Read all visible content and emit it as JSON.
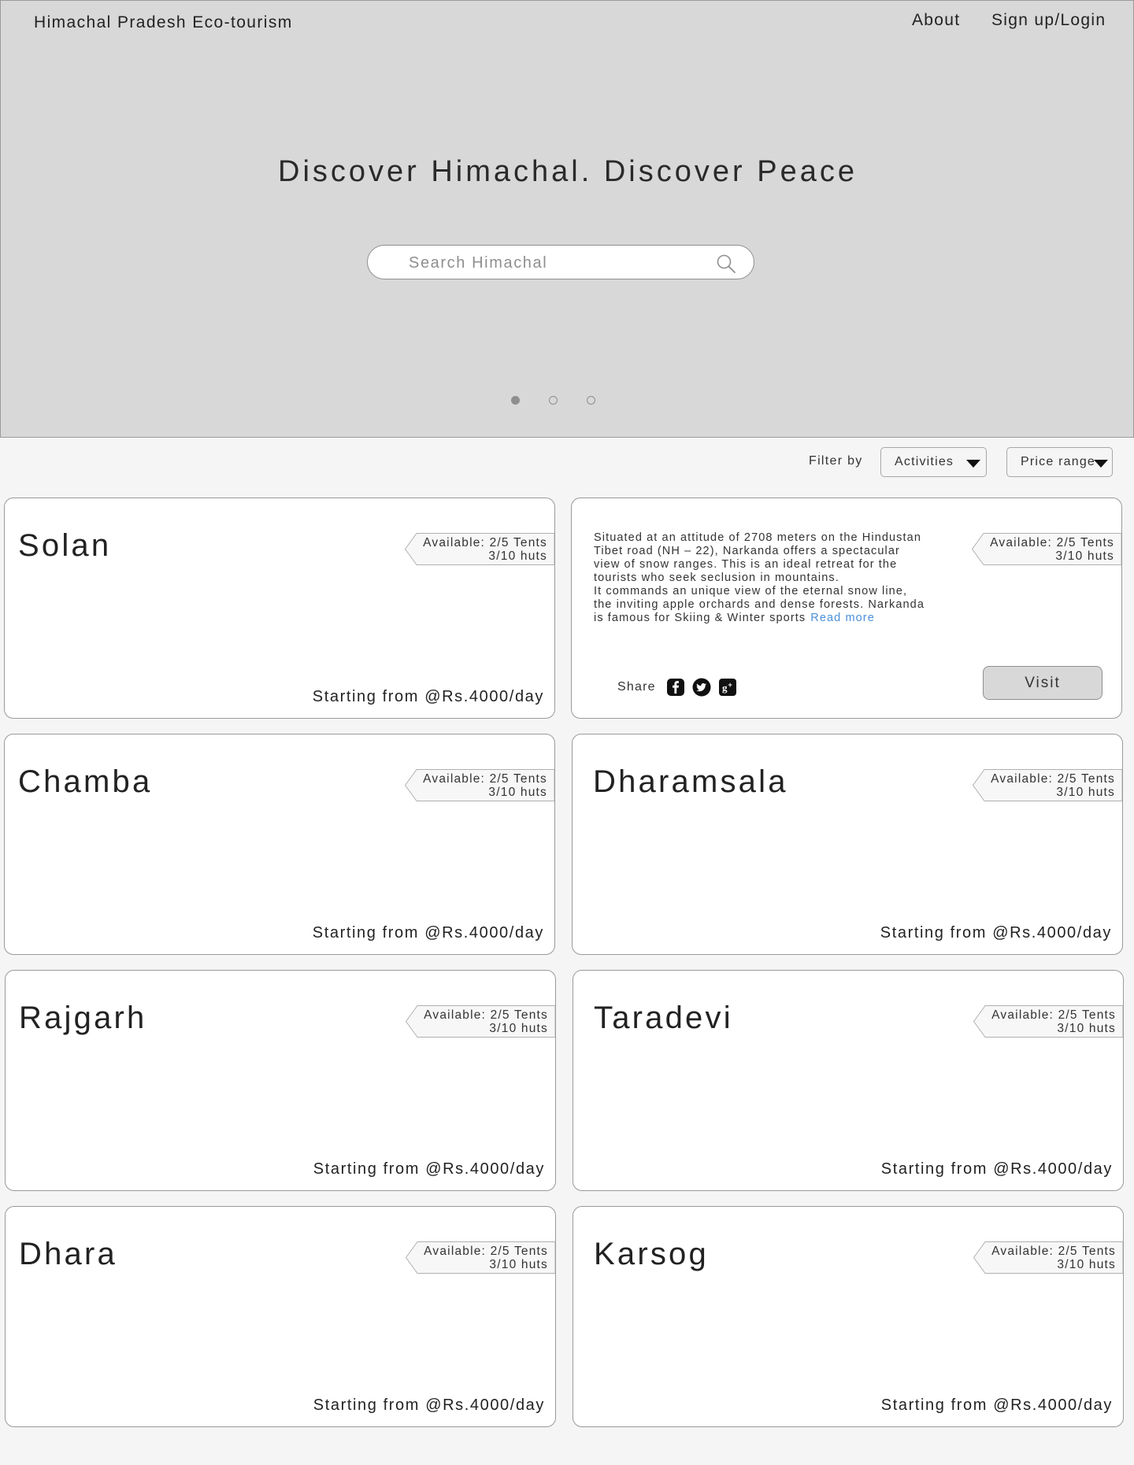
{
  "header": {
    "brand": "Himachal Pradesh Eco-tourism",
    "nav": {
      "about": "About",
      "login": "Sign up/Login"
    }
  },
  "hero": {
    "title": "Discover Himachal. Discover Peace",
    "search_placeholder": "Search Himachal",
    "carousel": {
      "count": 3,
      "active_index": 0
    }
  },
  "filters": {
    "label": "Filter by",
    "activities": "Activities",
    "price_range": "Price range"
  },
  "featured": {
    "description_lines": [
      "Situated at an attitude of 2708 meters on the Hindustan Tibet road (NH – 22), Narkanda offers a spectacular view of snow ranges. This is an ideal retreat for the tourists who seek seclusion in mountains.",
      "It commands an unique view of the eternal snow line, the inviting apple orchards and dense forests. Narkanda is famous for Skiing & Winter sports"
    ],
    "read_more": "Read more",
    "share_label": "Share",
    "social_icons": [
      "facebook-icon",
      "twitter-icon",
      "google-plus-icon"
    ],
    "visit_label": "Visit",
    "availability": {
      "tents": "Available: 2/5 Tents",
      "huts": "3/10 huts"
    }
  },
  "cards": [
    {
      "name": "Solan",
      "tents": "Available: 2/5 Tents",
      "huts": "3/10 huts",
      "price": "Starting from @Rs.4000/day"
    },
    {
      "name": "Chamba",
      "tents": "Available: 2/5 Tents",
      "huts": "3/10 huts",
      "price": "Starting from @Rs.4000/day"
    },
    {
      "name": "Dharamsala",
      "tents": "Available: 2/5 Tents",
      "huts": "3/10 huts",
      "price": "Starting from @Rs.4000/day"
    },
    {
      "name": "Rajgarh",
      "tents": "Available: 2/5 Tents",
      "huts": "3/10 huts",
      "price": "Starting from @Rs.4000/day"
    },
    {
      "name": "Taradevi",
      "tents": "Available: 2/5 Tents",
      "huts": "3/10 huts",
      "price": "Starting from @Rs.4000/day"
    },
    {
      "name": "Dhara",
      "tents": "Available: 2/5 Tents",
      "huts": "3/10 huts",
      "price": "Starting from @Rs.4000/day"
    },
    {
      "name": "Karsog",
      "tents": "Available: 2/5 Tents",
      "huts": "3/10 huts",
      "price": "Starting from @Rs.4000/day"
    }
  ]
}
